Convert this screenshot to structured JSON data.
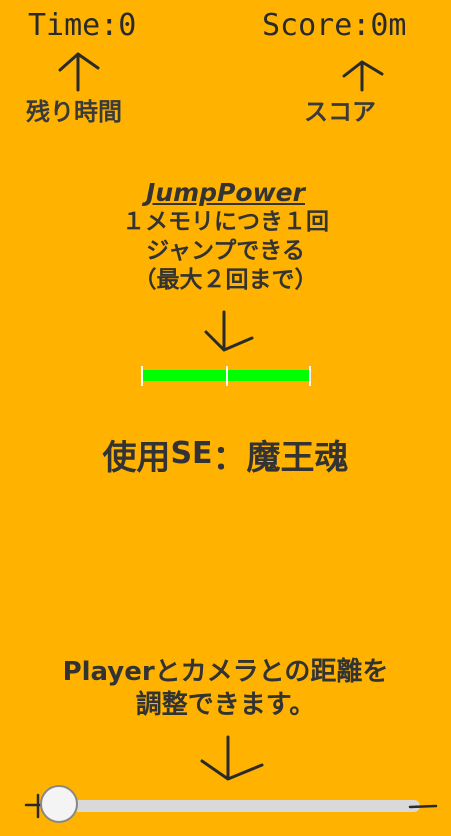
{
  "hud": {
    "time_text": "Time:0",
    "score_text": "Score:0m",
    "time_caption": "残り時間",
    "score_caption": "スコア"
  },
  "jump_power": {
    "title": "JumpPower",
    "line1": "１メモリにつき１回",
    "line2": "ジャンプできる",
    "line3": "（最大２回まで）",
    "gauge_level": 1.0,
    "gauge_segments": 2
  },
  "se": {
    "prefix": "使用",
    "se_text": "SE",
    "suffix": "：魔王魂"
  },
  "camera": {
    "line1": "Playerとカメラとの距離を",
    "line2": "調整できます。",
    "slider_value": 0
  },
  "colors": {
    "background": "#FFB300",
    "gauge": "#00FF00"
  }
}
